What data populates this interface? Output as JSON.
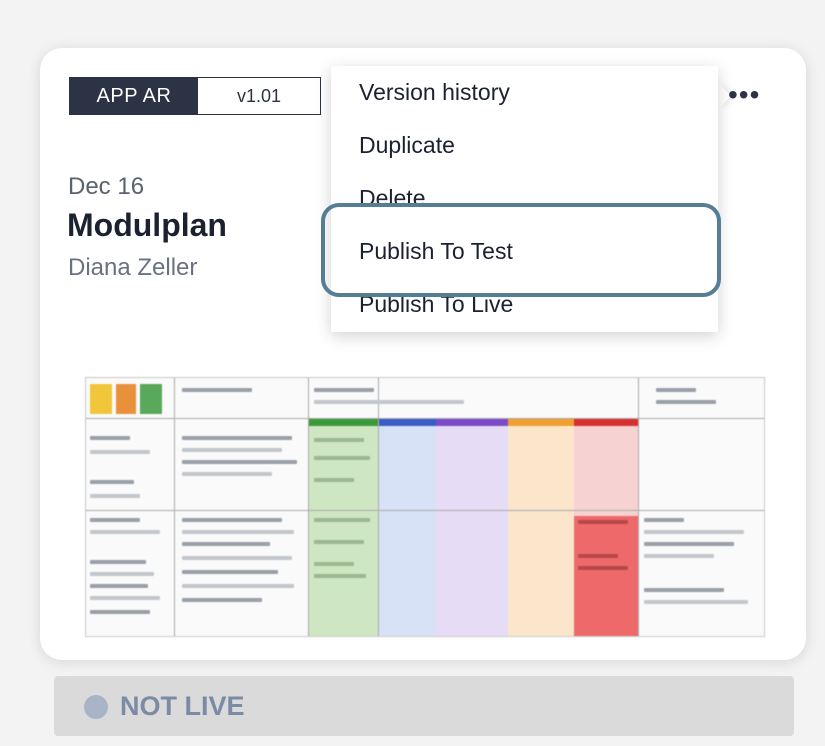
{
  "card": {
    "app_label": "APP AR",
    "version": "v1.01",
    "date": "Dec 16",
    "title": "Modulplan",
    "author": "Diana Zeller",
    "more_glyph": "•••"
  },
  "menu": {
    "items": [
      {
        "label": "Version history"
      },
      {
        "label": "Duplicate"
      },
      {
        "label": "Delete"
      },
      {
        "label": "Publish To Test"
      },
      {
        "label": "Publish To Live"
      }
    ],
    "highlighted_item": "Publish To Test",
    "highlight_color": "#557d95"
  },
  "status": {
    "label": "NOT LIVE",
    "dot_color": "#a9b4c8"
  },
  "thumbnail": {
    "colors": {
      "green": "#cfe6c2",
      "blue": "#d8e2f6",
      "purple": "#e6dcf6",
      "orange": "#fbe6cc",
      "red": "#f6d2d2",
      "red_strong": "#ee6a6a"
    }
  }
}
